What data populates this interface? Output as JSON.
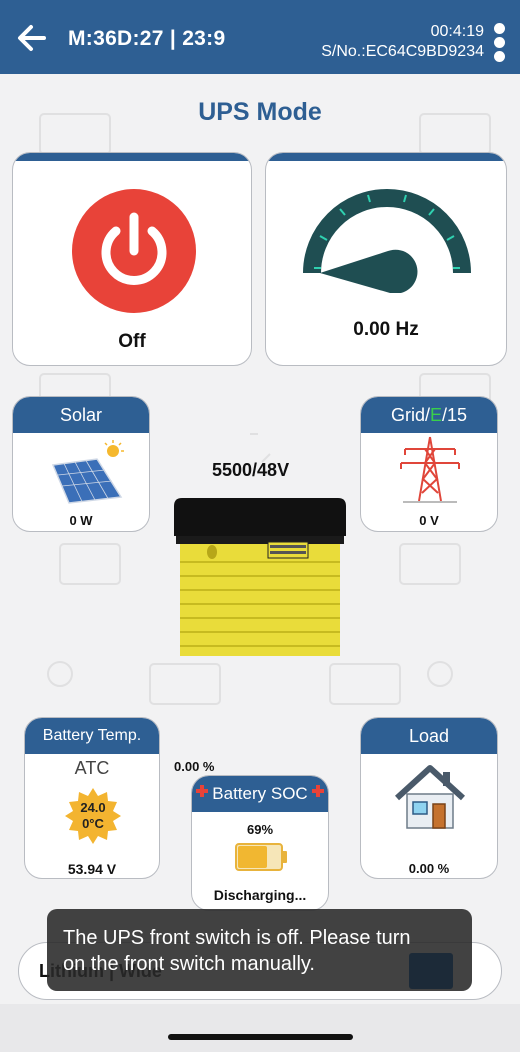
{
  "header": {
    "title": "M:36D:27 | 23:9",
    "clock": "00:4:19",
    "serial": "S/No.:EC64C9BD9234",
    "back_icon": "arrow-left-icon",
    "menu_icon": "kebab-menu-icon",
    "bg_color": "#2e5f93"
  },
  "page_title": "UPS Mode",
  "power": {
    "state": "Off",
    "icon": "power-icon",
    "color": "#e84339"
  },
  "frequency": {
    "value": "0.00 Hz",
    "gauge_level": 0
  },
  "solar": {
    "title": "Solar",
    "value": "0 W",
    "icon": "solar-panel-icon"
  },
  "grid": {
    "title_prefix": "Grid/",
    "title_e": "E",
    "title_suffix": "/15",
    "value": "0 V",
    "icon": "transmission-tower-icon"
  },
  "inverter": {
    "rating": "5500/48V",
    "icon": "inverter-icon",
    "color": "#f0e442"
  },
  "battery_temp": {
    "title": "Battery Temp.",
    "mode": "ATC",
    "temp_line1": "24.0",
    "temp_line2": "0°C",
    "voltage": "53.94 V"
  },
  "soc_top": "0.00 %",
  "battery_soc": {
    "title": "Battery SOC",
    "percent": "69%",
    "status": "Discharging...",
    "level": 0.69
  },
  "load": {
    "title": "Load",
    "value": "0.00 %",
    "icon": "house-icon"
  },
  "battery_type": "Lithium | Wide",
  "toast": {
    "line1": "The UPS front switch is off. Please turn",
    "line2": "on the front switch manually."
  }
}
